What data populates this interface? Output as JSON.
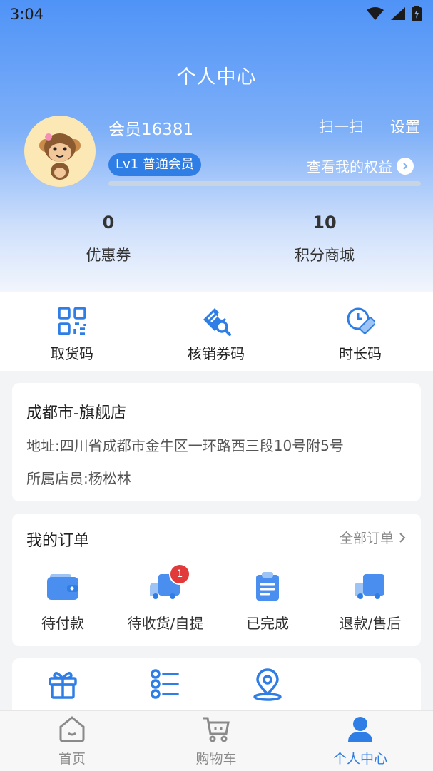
{
  "status": {
    "time": "3:04"
  },
  "header": {
    "title": "个人中心",
    "scan_label": "扫一扫",
    "settings_label": "设置"
  },
  "profile": {
    "member_name": "会员16381",
    "level": "Lv1 普通会员",
    "benefit_label": "查看我的权益",
    "progress": 0.0
  },
  "stats": [
    {
      "value": "0",
      "label": "优惠券"
    },
    {
      "value": "10",
      "label": "积分商城"
    }
  ],
  "quick": [
    {
      "label": "取货码",
      "icon": "qr-code-icon"
    },
    {
      "label": "核销券码",
      "icon": "voucher-search-icon"
    },
    {
      "label": "时长码",
      "icon": "timer-ruler-icon"
    }
  ],
  "store": {
    "name": "成都市-旗舰店",
    "address": "地址:四川省成都市金牛区一环路西三段10号附5号",
    "staff": "所属店员:杨松林"
  },
  "orders": {
    "title": "我的订单",
    "all_label": "全部订单",
    "items": [
      {
        "label": "待付款",
        "icon": "wallet-icon"
      },
      {
        "label": "待收货/自提",
        "icon": "delivery-truck-icon",
        "badge": "1"
      },
      {
        "label": "已完成",
        "icon": "clipboard-icon"
      },
      {
        "label": "退款/售后",
        "icon": "return-truck-icon"
      }
    ]
  },
  "extra": [
    {
      "icon": "gift-icon"
    },
    {
      "icon": "list-icon"
    },
    {
      "icon": "location-pin-icon"
    }
  ],
  "tabs": [
    {
      "label": "首页",
      "icon": "home-icon",
      "active": false
    },
    {
      "label": "购物车",
      "icon": "cart-icon",
      "active": false
    },
    {
      "label": "个人中心",
      "icon": "user-icon",
      "active": true
    }
  ],
  "colors": {
    "accent": "#2f7ee6",
    "tab_inactive": "#8a8a8a",
    "badge": "#e23a3a"
  }
}
